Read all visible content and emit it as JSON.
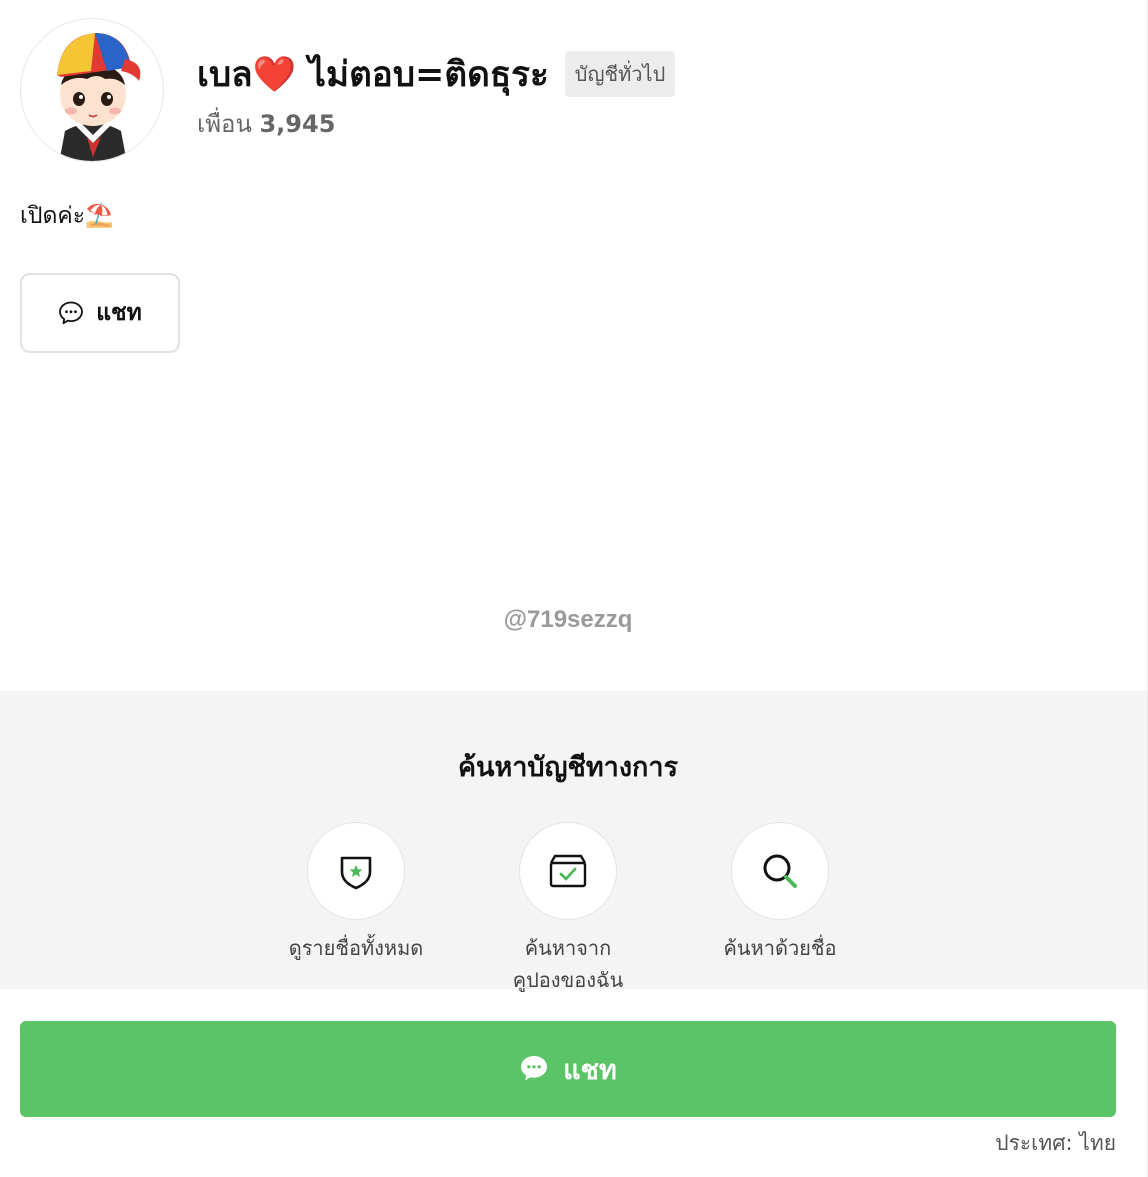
{
  "profile": {
    "display_name": "เบล❤️ ไม่ตอบ=ติดธุระ",
    "account_type_badge": "บัญชีทั่วไป",
    "friends_label": "เพื่อน",
    "friends_count": "3,945",
    "status_message": "เปิดค่ะ⛱️",
    "line_id": "@719sezzq",
    "avatar_icon": "cartoon-boy-avatar"
  },
  "actions": {
    "chat_label": "แชท",
    "chat_icon": "speech-bubble-icon"
  },
  "discover": {
    "title": "ค้นหาบัญชีทางการ",
    "shortcuts": [
      {
        "label_line1": "ดูรายชื่อทั้งหมด",
        "label_line2": "",
        "icon": "shield-star-icon"
      },
      {
        "label_line1": "ค้นหาจาก",
        "label_line2": "คูปองของฉัน",
        "icon": "coupon-box-icon"
      },
      {
        "label_line1": "ค้นหาด้วยชื่อ",
        "label_line2": "",
        "icon": "search-icon"
      }
    ]
  },
  "footer": {
    "chat_label": "แชท",
    "country": "ประเทศ: ไทย"
  },
  "colors": {
    "accent_green": "#5bc466",
    "section_grey": "#f4f4f4",
    "badge_grey": "#ececec"
  }
}
